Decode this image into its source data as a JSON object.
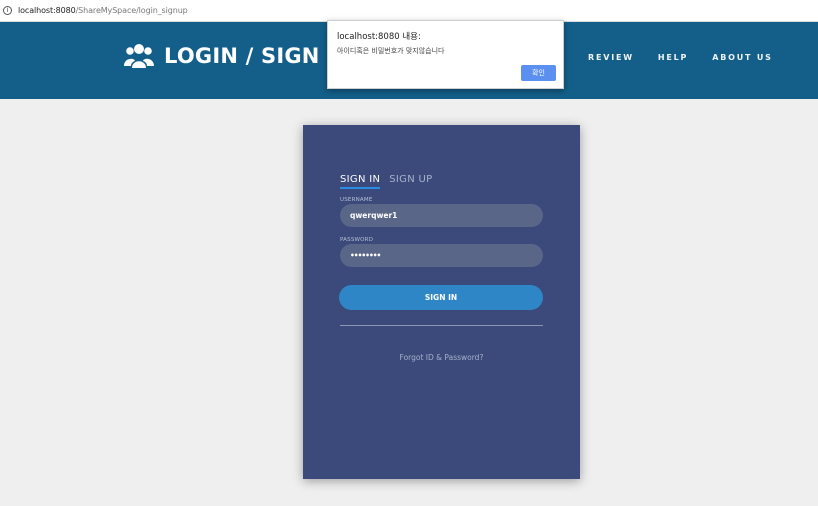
{
  "browser": {
    "url_host": "localhost:8080",
    "url_path": "/ShareMySpace/login_signup"
  },
  "header": {
    "title": "LOGIN / SIGN UP",
    "nav": [
      "REVIEW",
      "HELP",
      "ABOUT US"
    ],
    "logo_icon": "users-icon",
    "background": "#135f89"
  },
  "dialog": {
    "title": "localhost:8080 내용:",
    "message": "아이디혹은 비밀번호가 맞지않습니다",
    "ok_label": "확인"
  },
  "form": {
    "tabs": [
      "SIGN IN",
      "SIGN UP"
    ],
    "username_label": "USERNAME",
    "username_value": "qwerqwer1",
    "password_label": "PASSWORD",
    "password_value": "••••••••",
    "submit_label": "SIGN IN",
    "forgot_link": "Forgot ID & Password?"
  },
  "colors": {
    "card": "#3b4a7a",
    "button": "#2f86c6",
    "accent": "#2a8ee0"
  }
}
